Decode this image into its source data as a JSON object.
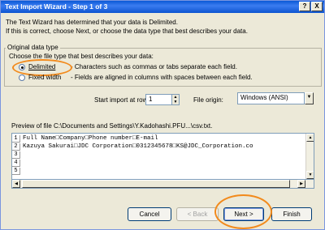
{
  "window": {
    "title": "Text Import Wizard - Step 1 of 3",
    "help_btn": "?",
    "close_btn": "X"
  },
  "intro": {
    "line1": "The Text Wizard has determined that your data is Delimited.",
    "line2": "If this is correct, choose Next, or choose the data type that best describes your data."
  },
  "original_data_type": {
    "group_label": "Original data type",
    "prompt": "Choose the file type that best describes your data:",
    "options": [
      {
        "label": "Delimited",
        "description": "- Characters such as commas or tabs separate each field.",
        "selected": true
      },
      {
        "label": "Fixed width",
        "description": "- Fields are aligned in columns with spaces between each field.",
        "selected": false
      }
    ]
  },
  "start_import": {
    "label": "Start import at row:",
    "value": "1"
  },
  "file_origin": {
    "label": "File origin:",
    "value": "Windows (ANSI)"
  },
  "preview": {
    "label": "Preview of file C:\\Documents and Settings\\Y.Kadohashi.PFU...\\csv.txt.",
    "row_numbers": [
      "1",
      "2",
      "3",
      "4",
      "5"
    ],
    "lines": [
      "Full Name□Company□Phone number□E-mail",
      "Kazuya Sakurai□JDC Corporation□0312345678□KS@JDC_Corporation.co",
      "",
      "",
      ""
    ]
  },
  "buttons": {
    "cancel": "Cancel",
    "back": "< Back",
    "next": "Next >",
    "finish": "Finish"
  },
  "colors": {
    "highlight_ring": "#f28a1c",
    "title_bar": "#0a58d6"
  }
}
